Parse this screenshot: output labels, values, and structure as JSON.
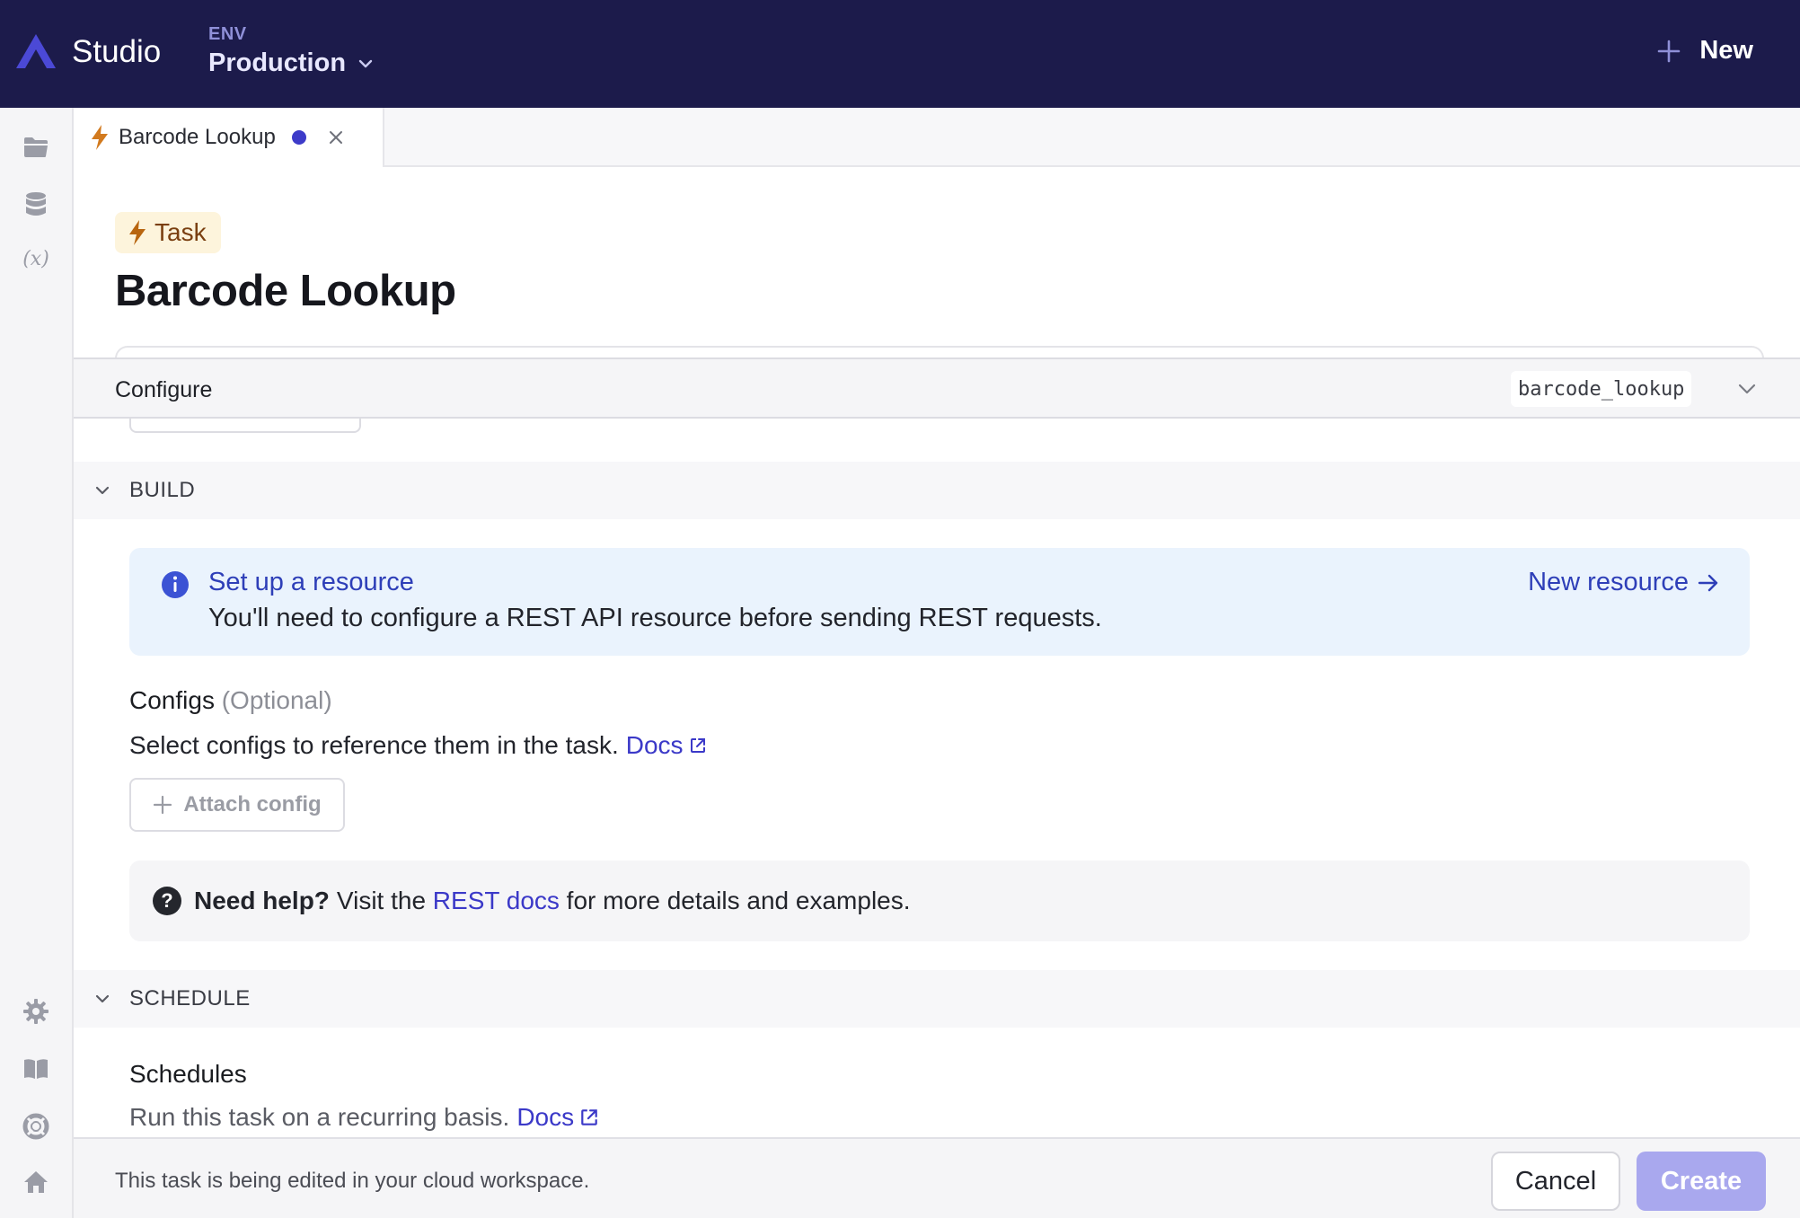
{
  "app": {
    "brand": "Studio",
    "env_label": "ENV",
    "env_value": "Production",
    "new_label": "New"
  },
  "rail": {
    "top_icons": [
      "folder-icon",
      "database-icon",
      "variable-icon"
    ],
    "variable_glyph": "(x)",
    "bottom_icons": [
      "settings-icon",
      "book-icon",
      "help-lifebuoy-icon",
      "home-icon"
    ]
  },
  "tab": {
    "title": "Barcode Lookup",
    "unsaved": true
  },
  "header": {
    "badge": "Task",
    "title": "Barcode Lookup"
  },
  "configure": {
    "label": "Configure",
    "slug": "barcode_lookup"
  },
  "build": {
    "section_label": "BUILD",
    "callout": {
      "title": "Set up a resource",
      "body": "You'll need to configure a REST API resource before sending REST requests.",
      "link": "New resource"
    },
    "configs": {
      "title": "Configs",
      "optional": "(Optional)",
      "description": "Select configs to reference them in the task.",
      "docs_link": "Docs",
      "attach_label": "Attach config"
    },
    "help": {
      "strong": "Need help?",
      "prefix": "Visit the",
      "link": "REST docs",
      "suffix": "for more details and examples."
    }
  },
  "schedule": {
    "section_label": "SCHEDULE",
    "title": "Schedules",
    "description": "Run this task on a recurring basis.",
    "docs_link": "Docs"
  },
  "footer": {
    "note": "This task is being edited in your cloud workspace.",
    "cancel_label": "Cancel",
    "create_label": "Create"
  },
  "colors": {
    "topbar": "#1c1b4b",
    "accent": "#3b39c8",
    "callout_bg": "#eaf3fd",
    "badge_bg": "#fdf4dc",
    "create_disabled": "#a9a8ee"
  }
}
